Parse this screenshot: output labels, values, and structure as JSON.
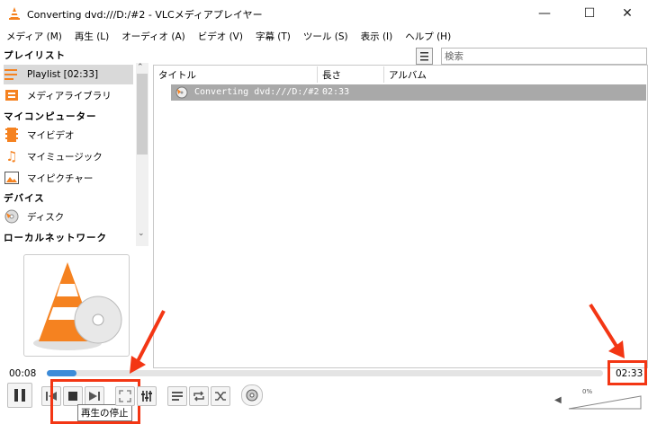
{
  "window": {
    "title": "Converting dvd:///D:/#2 - VLCメディアプレイヤー",
    "minimize": "—",
    "maximize": "☐",
    "close": "✕"
  },
  "menu": [
    "メディア (M)",
    "再生 (L)",
    "オーディオ (A)",
    "ビデオ (V)",
    "字幕 (T)",
    "ツール (S)",
    "表示 (I)",
    "ヘルプ (H)"
  ],
  "sidebar": {
    "playlist_header": "プレイリスト",
    "playlist_item": "Playlist [02:33]",
    "media_library": "メディアライブラリ",
    "my_computer_header": "マイコンピューター",
    "my_video": "マイビデオ",
    "my_music": "マイミュージック",
    "my_pictures": "マイピクチャー",
    "devices_header": "デバイス",
    "disc": "ディスク",
    "local_network_header": "ローカルネットワーク"
  },
  "search": {
    "placeholder": "検索"
  },
  "playlist": {
    "columns": [
      "タイトル",
      "長さ",
      "アルバム"
    ],
    "rows": [
      {
        "title": "Converting dvd:///D:/#2",
        "length": "02:33",
        "album": ""
      }
    ]
  },
  "controls": {
    "elapsed": "00:08",
    "total": "02:33",
    "progress_fraction": 0.053,
    "stop_tooltip": "再生の停止",
    "volume_label": "0%"
  },
  "colors": {
    "accent": "#3c8bd8",
    "highlight": "#f33614",
    "selected_row": "#a9a9a9",
    "vlc_orange": "#f58220"
  }
}
